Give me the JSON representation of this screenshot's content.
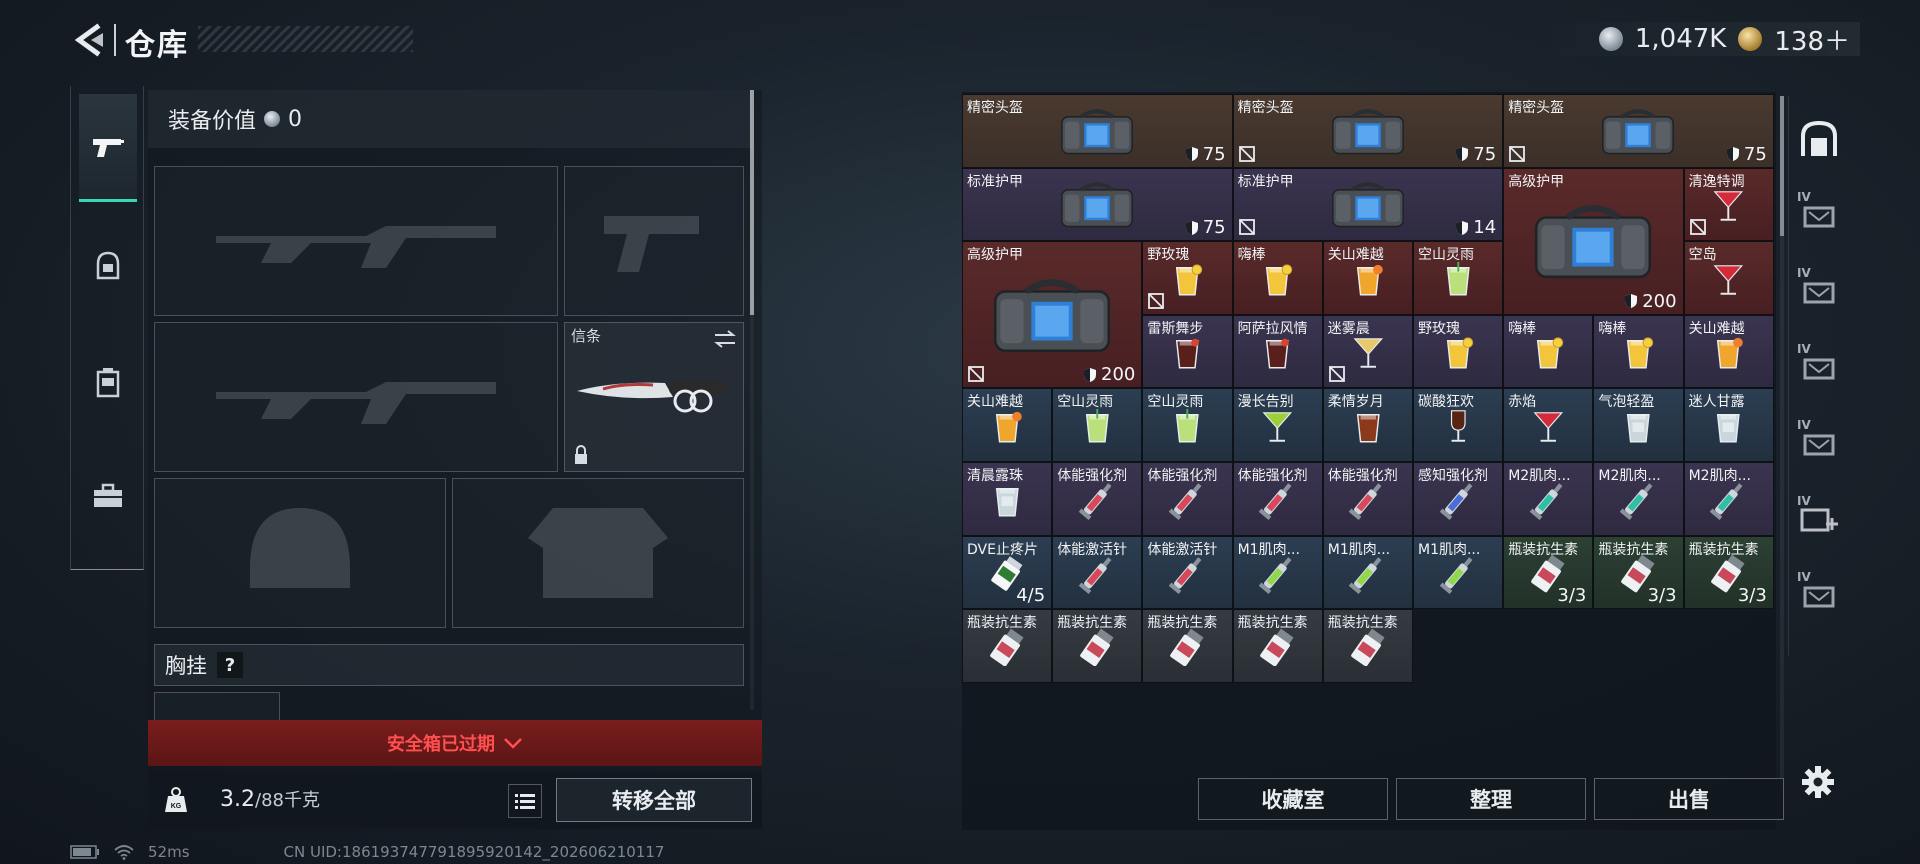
{
  "header": {
    "title": "仓库",
    "currency_silver": "1,047K",
    "currency_gold": "138＋"
  },
  "equip": {
    "value_label": "装备价值",
    "value_amount": "0",
    "knife_label": "信条",
    "chest_label": "胸挂",
    "chest_help": "?",
    "safebox_status": "安全箱已过期",
    "weight_current": "3.2",
    "weight_max": "/88千克",
    "transfer_all": "转移全部"
  },
  "inventory": {
    "cells": [
      {
        "name": "精密头盔",
        "col": 0,
        "row": 0,
        "w": 3,
        "h": 1,
        "rarity": "brown",
        "icon": "armor-bag",
        "value": "75",
        "nodrop": false
      },
      {
        "name": "精密头盔",
        "col": 3,
        "row": 0,
        "w": 3,
        "h": 1,
        "rarity": "brown",
        "icon": "armor-bag",
        "value": "75",
        "nodrop": true
      },
      {
        "name": "精密头盔",
        "col": 6,
        "row": 0,
        "w": 3,
        "h": 1,
        "rarity": "brown",
        "icon": "armor-bag",
        "value": "75",
        "nodrop": true
      },
      {
        "name": "标准护甲",
        "col": 0,
        "row": 1,
        "w": 3,
        "h": 1,
        "rarity": "purple",
        "icon": "armor-bag",
        "value": "75",
        "nodrop": false
      },
      {
        "name": "标准护甲",
        "col": 3,
        "row": 1,
        "w": 3,
        "h": 1,
        "rarity": "purple",
        "icon": "armor-bag",
        "value": "14",
        "nodrop": true
      },
      {
        "name": "高级护甲",
        "col": 6,
        "row": 1,
        "w": 2,
        "h": 2,
        "rarity": "red",
        "icon": "armor-bag-large",
        "value": "200",
        "nodrop": false
      },
      {
        "name": "清逸特调",
        "col": 8,
        "row": 1,
        "w": 1,
        "h": 1,
        "rarity": "red",
        "icon": "cocktail-red",
        "value": "",
        "nodrop": true
      },
      {
        "name": "高级护甲",
        "col": 0,
        "row": 2,
        "w": 2,
        "h": 2,
        "rarity": "red",
        "icon": "armor-bag-large",
        "value": "200",
        "nodrop": true
      },
      {
        "name": "野玫瑰",
        "col": 2,
        "row": 2,
        "w": 1,
        "h": 1,
        "rarity": "red",
        "icon": "drink-yellow",
        "value": "",
        "nodrop": true
      },
      {
        "name": "嗨棒",
        "col": 3,
        "row": 2,
        "w": 1,
        "h": 1,
        "rarity": "red",
        "icon": "drink-yellow",
        "value": "",
        "nodrop": false
      },
      {
        "name": "关山难越",
        "col": 4,
        "row": 2,
        "w": 1,
        "h": 1,
        "rarity": "red",
        "icon": "drink-orange",
        "value": "",
        "nodrop": false
      },
      {
        "name": "空山灵雨",
        "col": 5,
        "row": 2,
        "w": 1,
        "h": 1,
        "rarity": "red",
        "icon": "drink-green",
        "value": "",
        "nodrop": false
      },
      {
        "name": "空岛",
        "col": 8,
        "row": 2,
        "w": 1,
        "h": 1,
        "rarity": "red",
        "icon": "cocktail-red",
        "value": "",
        "nodrop": false
      },
      {
        "name": "雷斯舞步",
        "col": 2,
        "row": 3,
        "w": 1,
        "h": 1,
        "rarity": "purple",
        "icon": "drink-dark",
        "value": "",
        "nodrop": false
      },
      {
        "name": "阿萨拉风情",
        "col": 3,
        "row": 3,
        "w": 1,
        "h": 1,
        "rarity": "purple",
        "icon": "drink-dark",
        "value": "",
        "nodrop": false
      },
      {
        "name": "迷雾晨",
        "col": 4,
        "row": 3,
        "w": 1,
        "h": 1,
        "rarity": "purple",
        "icon": "cocktail-gold",
        "value": "",
        "nodrop": true
      },
      {
        "name": "野玫瑰",
        "col": 5,
        "row": 3,
        "w": 1,
        "h": 1,
        "rarity": "purple",
        "icon": "drink-yellow",
        "value": "",
        "nodrop": false
      },
      {
        "name": "嗨棒",
        "col": 6,
        "row": 3,
        "w": 1,
        "h": 1,
        "rarity": "purple",
        "icon": "drink-yellow",
        "value": "",
        "nodrop": false
      },
      {
        "name": "嗨棒",
        "col": 7,
        "row": 3,
        "w": 1,
        "h": 1,
        "rarity": "purple",
        "icon": "drink-yellow",
        "value": "",
        "nodrop": false
      },
      {
        "name": "关山难越",
        "col": 8,
        "row": 3,
        "w": 1,
        "h": 1,
        "rarity": "purple",
        "icon": "drink-orange",
        "value": "",
        "nodrop": false
      },
      {
        "name": "关山难越",
        "col": 0,
        "row": 4,
        "w": 1,
        "h": 1,
        "rarity": "blue",
        "icon": "drink-orange",
        "value": "",
        "nodrop": false
      },
      {
        "name": "空山灵雨",
        "col": 1,
        "row": 4,
        "w": 1,
        "h": 1,
        "rarity": "blue",
        "icon": "drink-green",
        "value": "",
        "nodrop": false
      },
      {
        "name": "空山灵雨",
        "col": 2,
        "row": 4,
        "w": 1,
        "h": 1,
        "rarity": "blue",
        "icon": "drink-green",
        "value": "",
        "nodrop": false
      },
      {
        "name": "漫长告别",
        "col": 3,
        "row": 4,
        "w": 1,
        "h": 1,
        "rarity": "blue",
        "icon": "cocktail-green",
        "value": "",
        "nodrop": false
      },
      {
        "name": "柔情岁月",
        "col": 4,
        "row": 4,
        "w": 1,
        "h": 1,
        "rarity": "blue",
        "icon": "drink-brown",
        "value": "",
        "nodrop": false
      },
      {
        "name": "碳酸狂欢",
        "col": 5,
        "row": 4,
        "w": 1,
        "h": 1,
        "rarity": "blue",
        "icon": "wine-dark",
        "value": "",
        "nodrop": false
      },
      {
        "name": "赤焰",
        "col": 6,
        "row": 4,
        "w": 1,
        "h": 1,
        "rarity": "blue",
        "icon": "cocktail-red",
        "value": "",
        "nodrop": false
      },
      {
        "name": "气泡轻盈",
        "col": 7,
        "row": 4,
        "w": 1,
        "h": 1,
        "rarity": "blue",
        "icon": "drink-clear",
        "value": "",
        "nodrop": false
      },
      {
        "name": "迷人甘露",
        "col": 8,
        "row": 4,
        "w": 1,
        "h": 1,
        "rarity": "blue",
        "icon": "drink-clear",
        "value": "",
        "nodrop": false
      },
      {
        "name": "清晨露珠",
        "col": 0,
        "row": 5,
        "w": 1,
        "h": 1,
        "rarity": "purple",
        "icon": "drink-clear",
        "value": "",
        "nodrop": false
      },
      {
        "name": "体能强化剂",
        "col": 1,
        "row": 5,
        "w": 1,
        "h": 1,
        "rarity": "purple",
        "icon": "syringe-red",
        "value": "",
        "nodrop": false
      },
      {
        "name": "体能强化剂",
        "col": 2,
        "row": 5,
        "w": 1,
        "h": 1,
        "rarity": "purple",
        "icon": "syringe-red",
        "value": "",
        "nodrop": false
      },
      {
        "name": "体能强化剂",
        "col": 3,
        "row": 5,
        "w": 1,
        "h": 1,
        "rarity": "purple",
        "icon": "syringe-red",
        "value": "",
        "nodrop": false
      },
      {
        "name": "体能强化剂",
        "col": 4,
        "row": 5,
        "w": 1,
        "h": 1,
        "rarity": "purple",
        "icon": "syringe-red",
        "value": "",
        "nodrop": false
      },
      {
        "name": "感知强化剂",
        "col": 5,
        "row": 5,
        "w": 1,
        "h": 1,
        "rarity": "purple",
        "icon": "syringe-blue",
        "value": "",
        "nodrop": false
      },
      {
        "name": "M2肌肉...",
        "col": 6,
        "row": 5,
        "w": 1,
        "h": 1,
        "rarity": "purple",
        "icon": "syringe-teal",
        "value": "",
        "nodrop": false
      },
      {
        "name": "M2肌肉...",
        "col": 7,
        "row": 5,
        "w": 1,
        "h": 1,
        "rarity": "purple",
        "icon": "syringe-teal",
        "value": "",
        "nodrop": false
      },
      {
        "name": "M2肌肉...",
        "col": 8,
        "row": 5,
        "w": 1,
        "h": 1,
        "rarity": "purple",
        "icon": "syringe-teal",
        "value": "",
        "nodrop": false
      },
      {
        "name": "DVE止疼片",
        "col": 0,
        "row": 6,
        "w": 1,
        "h": 1,
        "rarity": "blue",
        "icon": "pill-bottle",
        "value": "",
        "count": "4/5",
        "nodrop": false
      },
      {
        "name": "体能激活针",
        "col": 1,
        "row": 6,
        "w": 1,
        "h": 1,
        "rarity": "blue",
        "icon": "syringe-red",
        "value": "",
        "nodrop": false
      },
      {
        "name": "体能激活针",
        "col": 2,
        "row": 6,
        "w": 1,
        "h": 1,
        "rarity": "blue",
        "icon": "syringe-red",
        "value": "",
        "nodrop": false
      },
      {
        "name": "M1肌肉...",
        "col": 3,
        "row": 6,
        "w": 1,
        "h": 1,
        "rarity": "blue",
        "icon": "syringe-lime",
        "value": "",
        "nodrop": false
      },
      {
        "name": "M1肌肉...",
        "col": 4,
        "row": 6,
        "w": 1,
        "h": 1,
        "rarity": "blue",
        "icon": "syringe-lime",
        "value": "",
        "nodrop": false
      },
      {
        "name": "M1肌肉...",
        "col": 5,
        "row": 6,
        "w": 1,
        "h": 1,
        "rarity": "blue",
        "icon": "syringe-lime",
        "value": "",
        "nodrop": false
      },
      {
        "name": "瓶装抗生素",
        "col": 6,
        "row": 6,
        "w": 1,
        "h": 1,
        "rarity": "green",
        "icon": "antibiotic-bottle",
        "value": "",
        "count": "3/3",
        "nodrop": false
      },
      {
        "name": "瓶装抗生素",
        "col": 7,
        "row": 6,
        "w": 1,
        "h": 1,
        "rarity": "green",
        "icon": "antibiotic-bottle",
        "value": "",
        "count": "3/3",
        "nodrop": false
      },
      {
        "name": "瓶装抗生素",
        "col": 8,
        "row": 6,
        "w": 1,
        "h": 1,
        "rarity": "green",
        "icon": "antibiotic-bottle",
        "value": "",
        "count": "3/3",
        "nodrop": false
      },
      {
        "name": "瓶装抗生素",
        "col": 0,
        "row": 7,
        "w": 1,
        "h": 1,
        "rarity": "gray",
        "icon": "antibiotic-bottle",
        "value": "",
        "nodrop": false
      },
      {
        "name": "瓶装抗生素",
        "col": 1,
        "row": 7,
        "w": 1,
        "h": 1,
        "rarity": "gray",
        "icon": "antibiotic-bottle",
        "value": "",
        "nodrop": false
      },
      {
        "name": "瓶装抗生素",
        "col": 2,
        "row": 7,
        "w": 1,
        "h": 1,
        "rarity": "gray",
        "icon": "antibiotic-bottle",
        "value": "",
        "nodrop": false
      },
      {
        "name": "瓶装抗生素",
        "col": 3,
        "row": 7,
        "w": 1,
        "h": 1,
        "rarity": "gray",
        "icon": "antibiotic-bottle",
        "value": "",
        "nodrop": false
      },
      {
        "name": "瓶装抗生素",
        "col": 4,
        "row": 7,
        "w": 1,
        "h": 1,
        "rarity": "gray",
        "icon": "antibiotic-bottle",
        "value": "",
        "nodrop": false
      }
    ],
    "buttons": {
      "collection": "收藏室",
      "sort": "整理",
      "sell": "出售"
    }
  },
  "side_rail": [
    {
      "icon": "vault-icon",
      "tier": ""
    },
    {
      "icon": "storage-iv-icon",
      "tier": "IV"
    },
    {
      "icon": "storage-iv-icon",
      "tier": "IV"
    },
    {
      "icon": "storage-iv-icon",
      "tier": "IV"
    },
    {
      "icon": "storage-iv-icon",
      "tier": "IV"
    },
    {
      "icon": "storage-add-icon",
      "tier": "IV"
    },
    {
      "icon": "storage-iv-icon",
      "tier": "IV"
    }
  ],
  "status": {
    "ping": "52ms",
    "uid": "CN UID:1861937477918959201​42_202606210117"
  },
  "colors": {
    "accent": "#39d6b3",
    "danger": "#ff4f4f"
  }
}
